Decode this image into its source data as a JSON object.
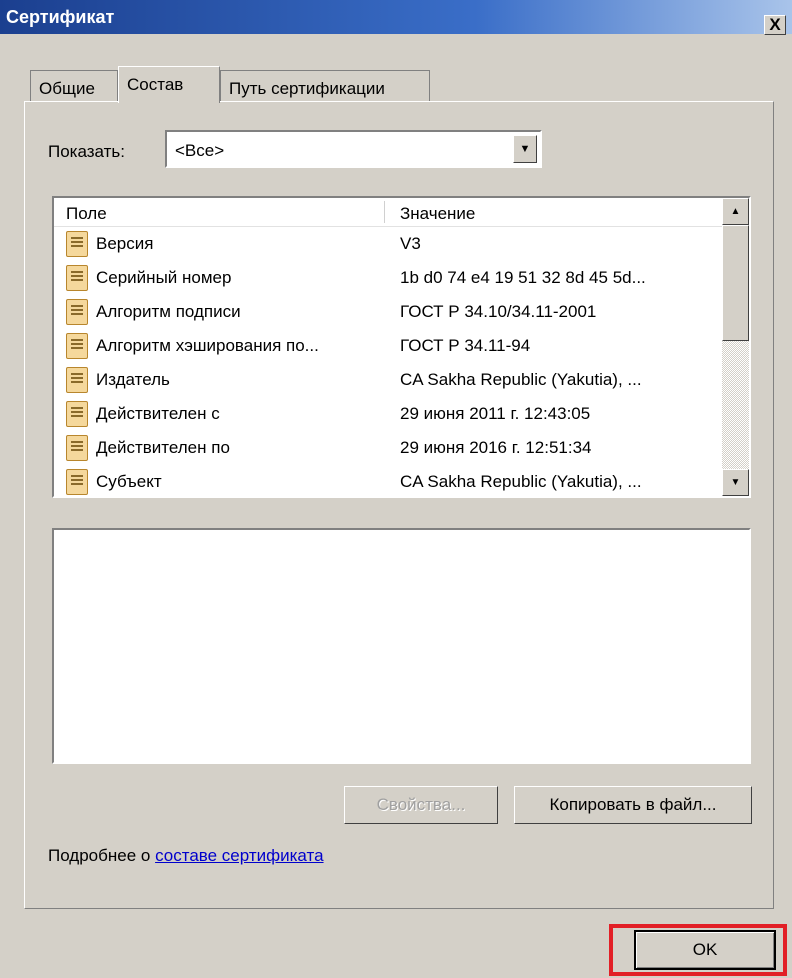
{
  "window": {
    "title": "Сертификат",
    "close_label": "X"
  },
  "tabs": [
    {
      "label": "Общие"
    },
    {
      "label": "Состав",
      "active": true
    },
    {
      "label": "Путь сертификации"
    }
  ],
  "filter": {
    "label": "Показать:",
    "value": "<Все>"
  },
  "table": {
    "columns": [
      "Поле",
      "Значение"
    ],
    "rows": [
      {
        "field": "Версия",
        "value": "V3"
      },
      {
        "field": "Серийный номер",
        "value": "1b d0 74 e4 19 51 32 8d 45 5d..."
      },
      {
        "field": "Алгоритм подписи",
        "value": "ГОСТ Р 34.10/34.11-2001"
      },
      {
        "field": "Алгоритм хэширования по...",
        "value": "ГОСТ Р 34.11-94"
      },
      {
        "field": "Издатель",
        "value": "CA Sakha Republic (Yakutia), ..."
      },
      {
        "field": "Действителен с",
        "value": "29 июня 2011 г. 12:43:05"
      },
      {
        "field": "Действителен по",
        "value": "29 июня 2016 г. 12:51:34"
      },
      {
        "field": "Субъект",
        "value": "CA Sakha Republic (Yakutia), ..."
      }
    ]
  },
  "buttons": {
    "properties": "Свойства...",
    "copy_to_file": "Копировать в файл...",
    "ok": "OK"
  },
  "more_info": {
    "prefix": "Подробнее о ",
    "link": "составе сертификата"
  },
  "icons": {
    "field_icon": "certificate-field-icon",
    "scroll_up": "scroll-up-arrow-icon",
    "scroll_down": "scroll-down-arrow-icon",
    "dropdown": "dropdown-arrow-icon"
  },
  "colors": {
    "title_bar": "#1b3f8f",
    "dialog_bg": "#d4d0c8",
    "link": "#0000cc",
    "highlight": "#e21f26"
  }
}
